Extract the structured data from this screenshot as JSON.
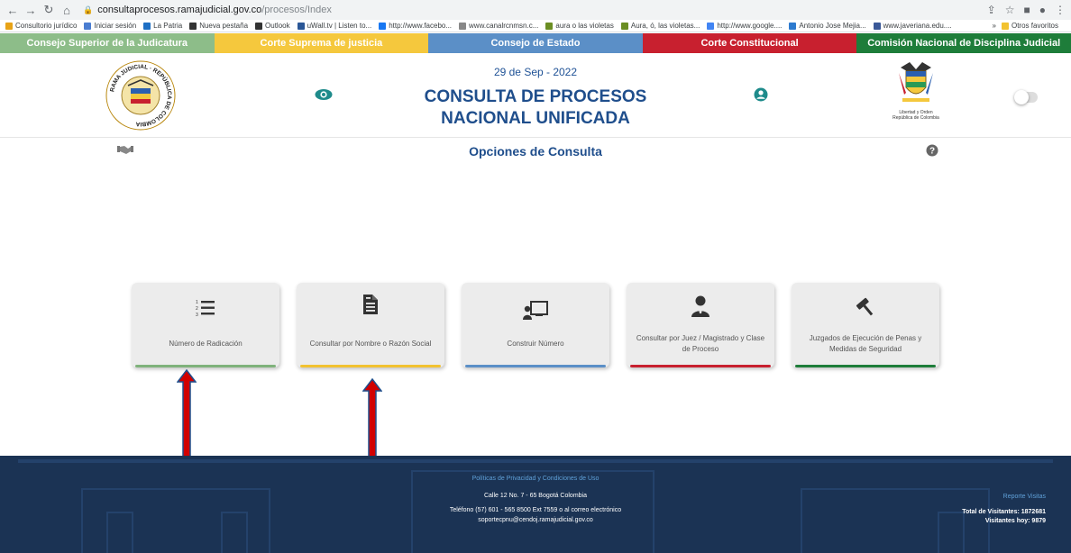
{
  "browser": {
    "url_host": "consultaprocesos.ramajudicial.gov.co",
    "url_path": "/procesos/Index",
    "bookmarks": [
      {
        "label": "Consultorio jurídico",
        "color": "#e8a317"
      },
      {
        "label": "Iniciar sesión",
        "color": "#4a7dd1"
      },
      {
        "label": "La Patria",
        "color": "#1e6fc4"
      },
      {
        "label": "Nueva pestaña",
        "color": "#333333"
      },
      {
        "label": "Outlook",
        "color": "#333333"
      },
      {
        "label": "uWall.tv | Listen to...",
        "color": "#2b5797"
      },
      {
        "label": "http://www.facebo...",
        "color": "#1877f2"
      },
      {
        "label": "www.canalrcnmsn.c...",
        "color": "#888888"
      },
      {
        "label": "aura o las violetas",
        "color": "#6b8e23"
      },
      {
        "label": "Aura, ó, las violetas...",
        "color": "#6b8e23"
      },
      {
        "label": "http://www.google....",
        "color": "#4285f4"
      },
      {
        "label": "Antonio Jose Mejia...",
        "color": "#2e7bcf"
      },
      {
        "label": "www.javeriana.edu....",
        "color": "#3b5998"
      }
    ],
    "other_favs": "Otros favoritos"
  },
  "topnav": [
    {
      "label": "Consejo Superior de la Judicatura",
      "color": "#8dbd89"
    },
    {
      "label": "Corte Suprema de justicia",
      "color": "#f5c83d"
    },
    {
      "label": "Consejo de Estado",
      "color": "#5b8fc7"
    },
    {
      "label": "Corte Constitucional",
      "color": "#c8202f"
    },
    {
      "label": "Comisión Nacional de Disciplina Judicial",
      "color": "#1e7d3a"
    }
  ],
  "header": {
    "date": "29 de Sep - 2022",
    "title_line1": "CONSULTA DE PROCESOS",
    "title_line2": "NACIONAL UNIFICADA",
    "seal_text": "RAMA JUDICIAL · REPÚBLICA DE COLOMBIA",
    "motto_line1": "Libertad y Orden",
    "motto_line2": "República de Colombia"
  },
  "options_title": "Opciones de Consulta",
  "cards": [
    {
      "label": "Número de Radicación",
      "icon": "numbered-list-icon",
      "bar_color": "#7fb27b"
    },
    {
      "label": "Consultar por Nombre o Razón Social",
      "icon": "document-icon",
      "bar_color": "#f2c230"
    },
    {
      "label": "Construir Número",
      "icon": "board-icon",
      "bar_color": "#5b8fc7"
    },
    {
      "label": "Consultar por Juez / Magistrado y Clase de Proceso",
      "icon": "judge-icon",
      "bar_color": "#c8202f"
    },
    {
      "label": "Juzgados de Ejecución de Penas y Medidas de Seguridad",
      "icon": "gavel-icon",
      "bar_color": "#1e7d3a"
    }
  ],
  "footer": {
    "policies": "Políticas de Privacidad y Condiciones de Uso",
    "address": "Calle 12 No. 7 - 65 Bogotá Colombia",
    "phone": "Teléfono (57) 601 - 565 8500 Ext 7559 o al correo electrónico",
    "email": "soportecpnu@cendoj.ramajudicial.gov.co",
    "report": "Reporte Visitas",
    "total_visits": "Total de Visitantes: 1872681",
    "today_visits": "Visitantes hoy: 9879"
  },
  "colors": {
    "brand_blue": "#1f4e8c",
    "footer_bg": "#1b3354",
    "arrow_red": "#d10000",
    "arrow_blue": "#1f4e8c"
  }
}
